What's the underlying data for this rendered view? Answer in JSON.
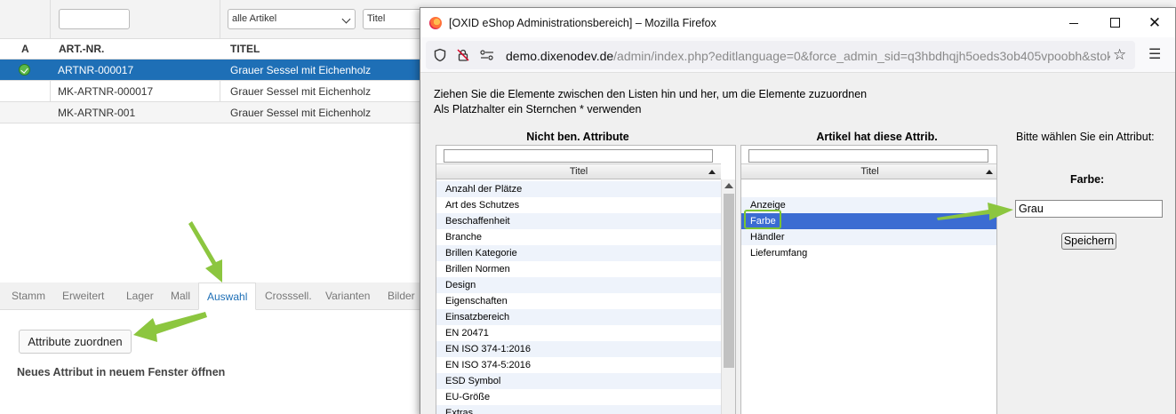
{
  "background": {
    "filters": {
      "artnum_value": "",
      "category_select": "alle Artikel",
      "title_placeholder": "Titel"
    },
    "columns": {
      "active": "A",
      "artnum": "ART.-NR.",
      "title": "TITEL"
    },
    "rows": [
      {
        "artnum": "ARTNR-000017",
        "title": "Grauer Sessel mit Eichenholz",
        "active": true,
        "selected": true
      },
      {
        "artnum": "MK-ARTNR-000017",
        "title": "Grauer Sessel mit Eichenholz",
        "active": false,
        "selected": false
      },
      {
        "artnum": "MK-ARTNR-001",
        "title": "Grauer Sessel mit Eichenholz",
        "active": false,
        "selected": false
      }
    ],
    "tabs": [
      "Stamm",
      "Erweitert",
      "Lager",
      "Mall",
      "Auswahl",
      "Crosssell.",
      "Varianten",
      "Bilder"
    ],
    "active_tab": "Auswahl",
    "assign_button": "Attribute zuordnen",
    "new_attribute_link": "Neues Attribut in neuem Fenster öffnen"
  },
  "popup": {
    "window_title": "[OXID eShop Administrationsbereich] – Mozilla Firefox",
    "url_domain": "demo.dixenodev.de",
    "url_rest": "/admin/index.php?editlanguage=0&force_admin_sid=q3hbdhqjh5oeds3ob405vpoobh&stok",
    "instruction_1": "Ziehen Sie die Elemente zwischen den Listen hin und her, um die Elemente zuzuordnen",
    "instruction_2": "Als Platzhalter ein Sternchen * verwenden",
    "left_list": {
      "title": "Nicht ben. Attribute",
      "column": "Titel",
      "items": [
        "Anzahl der Plätze",
        "Art des Schutzes",
        "Beschaffenheit",
        "Branche",
        "Brillen Kategorie",
        "Brillen Normen",
        "Design",
        "Eigenschaften",
        "Einsatzbereich",
        "EN 20471",
        "EN ISO 374-1:2016",
        "EN ISO 374-5:2016",
        "ESD Symbol",
        "EU-Größe",
        "Extras"
      ]
    },
    "right_list": {
      "title": "Artikel hat diese Attrib.",
      "column": "Titel",
      "items": [
        "Anzeige",
        "Farbe",
        "Händler",
        "Lieferumfang"
      ],
      "selected": "Farbe"
    },
    "attribute_panel": {
      "prompt": "Bitte wählen Sie ein Attribut:",
      "attribute_name": "Farbe",
      "value": "Grau",
      "save_button": "Speichern"
    }
  },
  "colors": {
    "selection_blue": "#1e6fb6",
    "list_selection": "#3b6cd2",
    "arrow_green": "#8cc63f"
  }
}
